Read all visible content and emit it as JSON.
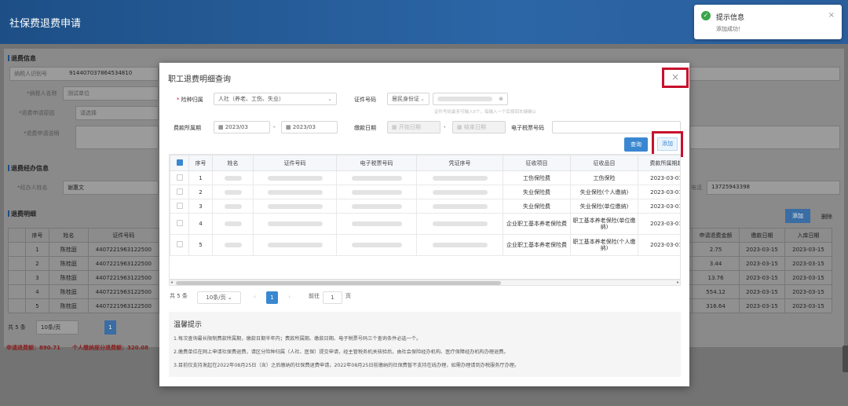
{
  "page": {
    "title": "社保费退费申请"
  },
  "background": {
    "sections": {
      "refund_info": "退费信息",
      "agent_info": "退费经办信息",
      "detail": "退费明细"
    },
    "fields": {
      "credit_code_label": "纳税人识别号",
      "credit_code_value": "914407037864534810",
      "payer_name_label": "*纳税人名称",
      "payer_name_value": "测试单位",
      "refund_reason_label": "*退费申请原因",
      "refund_reason_value": "请选择",
      "refund_desc_label": "*退费申请说明",
      "refund_desc_value": "请输入",
      "agent_label": "*经办人姓名",
      "agent_value": "谢惠文",
      "phone_label": "电话",
      "phone_value": "13725943398"
    },
    "buttons": {
      "add": "添加",
      "delete": "删除"
    },
    "table": {
      "headers": [
        "",
        "序号",
        "姓名",
        "证件号码",
        "申请退费金额",
        "缴款日期",
        "入库日期"
      ],
      "rows": [
        [
          "",
          "1",
          "陈桂庭",
          "4407221963122500",
          "2.75",
          "2023-03-15",
          "2023-03-15"
        ],
        [
          "",
          "2",
          "陈桂庭",
          "4407221963122500",
          "3.44",
          "2023-03-15",
          "2023-03-15"
        ],
        [
          "",
          "3",
          "陈桂庭",
          "4407221963122500",
          "13.76",
          "2023-03-15",
          "2023-03-15"
        ],
        [
          "",
          "4",
          "陈桂庭",
          "4407221963122500",
          "554.12",
          "2023-03-15",
          "2023-03-15"
        ],
        [
          "",
          "5",
          "陈桂庭",
          "4407221963122500",
          "316.64",
          "2023-03-15",
          "2023-03-15"
        ]
      ]
    },
    "pager": {
      "total": "共 5 条",
      "per_page": "10条/页",
      "page": "1"
    },
    "summary": {
      "apply_total": "申请退费额：890.71",
      "personal_total": "个人缴纳部分退费额：320.08"
    }
  },
  "toast": {
    "title": "提示信息",
    "message": "添加成功！",
    "close": "×"
  },
  "modal": {
    "title": "职工退费明细查询",
    "close": "×",
    "form": {
      "insurance_type_label": "险种归属",
      "insurance_type_value": "人社（养老、工伤、失业）",
      "id_no_label": "证件号码",
      "id_type_value": "居民身份证",
      "id_hint": "证件号码最多可输入5个，每输入一个后按回车键确认",
      "period_label": "费款所属期",
      "period_start": "2023/03",
      "period_end": "2023/03",
      "pay_date_label": "缴款日期",
      "pay_start_placeholder": "开始日期",
      "pay_end_placeholder": "结束日期",
      "ticket_label": "电子税票号码"
    },
    "buttons": {
      "query": "查询",
      "add": "添加"
    },
    "table": {
      "headers": [
        "",
        "序号",
        "姓名",
        "证件号码",
        "电子税票号码",
        "凭证序号",
        "征收项目",
        "征收品目",
        "费款所属期起"
      ],
      "rows": [
        {
          "no": "1",
          "item": "工伤保险费",
          "sub": "工伤保险",
          "period": "2023-03-01"
        },
        {
          "no": "2",
          "item": "失业保险费",
          "sub": "失业保险(个人缴纳)",
          "period": "2023-03-01"
        },
        {
          "no": "3",
          "item": "失业保险费",
          "sub": "失业保险(单位缴纳)",
          "period": "2023-03-01"
        },
        {
          "no": "4",
          "item": "企业职工基本养老保险费",
          "sub": "职工基本养老保险(单位缴纳)",
          "period": "2023-03-01"
        },
        {
          "no": "5",
          "item": "企业职工基本养老保险费",
          "sub": "职工基本养老保险(个人缴纳)",
          "period": "2023-03-01"
        }
      ]
    },
    "pager": {
      "total": "共 5 条",
      "per_page": "10条/页",
      "prev": "‹",
      "page": "1",
      "next": "›",
      "goto_label": "前往",
      "goto_value": "1",
      "goto_suffix": "页"
    },
    "tips": {
      "title": "温馨提示",
      "lines": [
        "1.每次查询最长限制费款所属期，缴款日期半年内；费款所属期、缴款日期、电子税票号码三个查询条件必选一个。",
        "2.缴费单位在网上申请社保费退费，请区分险种归属（人社、医保）提交申请，经主管税务机关核验后，由社会保险经办机构、医疗保障经办机构办理退费。",
        "3.目前仅支持发起在2022年08月25日（含）之后缴纳的社保费退费申请，2022年08月25日前缴纳的社保费暂不支持在线办理，如需办理请到办税服务厅办理。"
      ]
    }
  }
}
